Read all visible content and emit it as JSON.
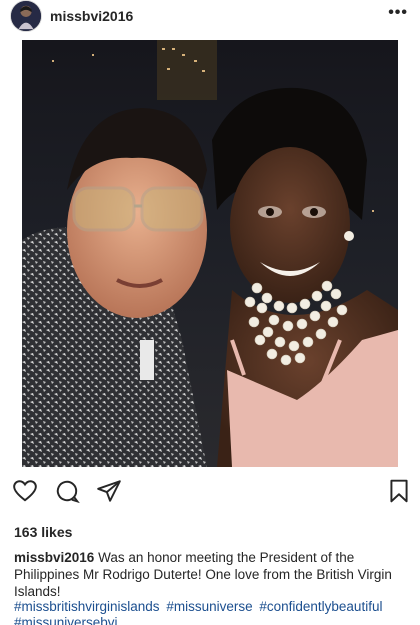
{
  "post": {
    "username": "missbvi2016",
    "more_label": "•••",
    "likes": "163 likes",
    "caption_user": "missbvi2016",
    "caption_text": "Was an honor meeting the President of the Philippines Mr Rodrigo Duterte! One love from the British Virgin Islands!",
    "hashtags": [
      "#missbritishvirginislands",
      "#missuniverse",
      "#confidentlybeautiful",
      "#missuniversebvi"
    ]
  },
  "icons": {
    "like": "heart-icon",
    "comment": "comment-icon",
    "share": "share-icon",
    "save": "bookmark-icon"
  },
  "colors": {
    "text": "#262626",
    "hashtag": "#1c4f8f",
    "dress": "#e8b9ae"
  }
}
